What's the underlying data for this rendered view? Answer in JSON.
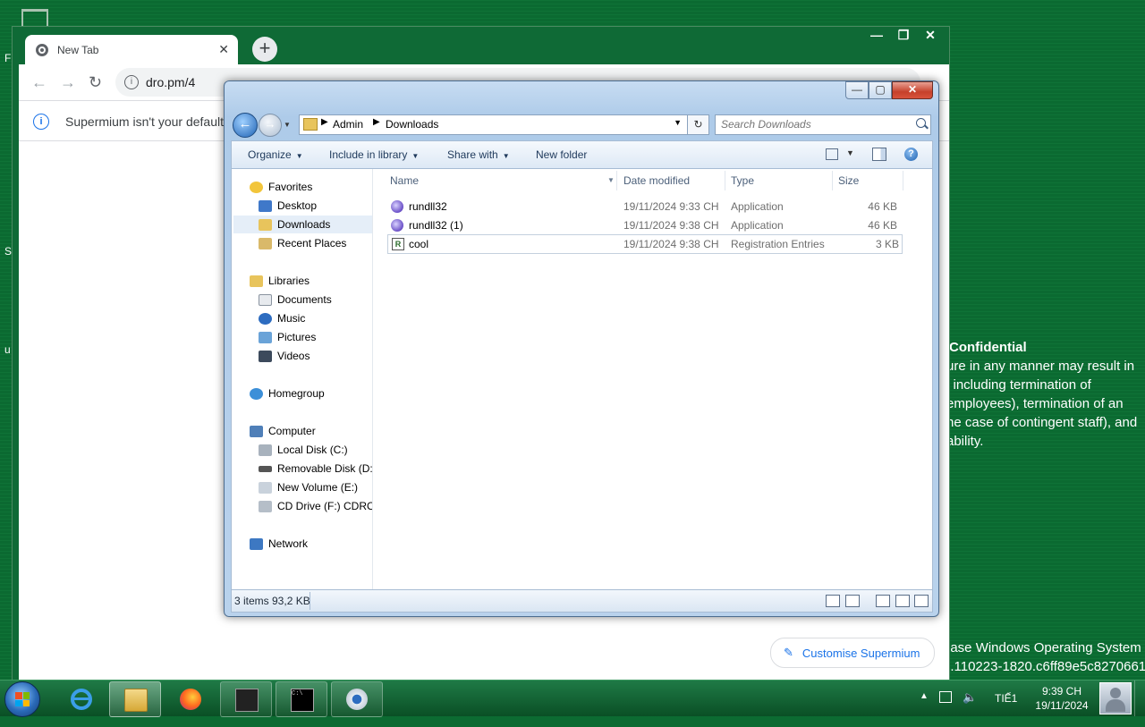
{
  "desktop": {
    "notice_title": "Confidential",
    "notice_lines": [
      "ure in any manner may result in",
      "l including termination of",
      "employees), termination of an",
      "ne case of contingent staff), and",
      "ability."
    ],
    "build_lines": [
      "ease Windows Operating System",
      "2.110223-1820.c6ff89e5c8270661"
    ],
    "edge_letters": [
      "F",
      "Su",
      "u"
    ]
  },
  "browser": {
    "tab_title": "New Tab",
    "tab_close": "✕",
    "new_tab": "+",
    "window_controls": [
      "—",
      "❐",
      "✕"
    ],
    "url": "dro.pm/4",
    "infobar_text": "Supermium isn't your default b",
    "customise_label": "Customise Supermium"
  },
  "explorer": {
    "window_controls": [
      "—",
      "▢",
      "✕"
    ],
    "address": {
      "crumbs": [
        "Admin",
        "Downloads"
      ]
    },
    "search_placeholder": "Search Downloads",
    "commands": {
      "organize": "Organize",
      "include_in_library": "Include in library",
      "share_with": "Share with",
      "new_folder": "New folder",
      "help": "?"
    },
    "nav": {
      "favorites": "Favorites",
      "desktop": "Desktop",
      "downloads": "Downloads",
      "recent_places": "Recent Places",
      "libraries": "Libraries",
      "documents": "Documents",
      "music": "Music",
      "pictures": "Pictures",
      "videos": "Videos",
      "homegroup": "Homegroup",
      "computer": "Computer",
      "local_disk": "Local Disk (C:)",
      "removable_disk": "Removable Disk (D:)",
      "new_volume": "New Volume (E:)",
      "cd_drive": "CD Drive (F:) CDROM",
      "network": "Network"
    },
    "columns": {
      "name": "Name",
      "date_modified": "Date modified",
      "type": "Type",
      "size": "Size"
    },
    "files": [
      {
        "name": "rundll32",
        "date": "19/11/2024 9:33 CH",
        "type": "Application",
        "size": "46 KB"
      },
      {
        "name": "rundll32 (1)",
        "date": "19/11/2024 9:38 CH",
        "type": "Application",
        "size": "46 KB"
      },
      {
        "name": "cool",
        "date": "19/11/2024 9:38 CH",
        "type": "Registration Entries",
        "size": "3 KB"
      }
    ],
    "status_text": "3 items 93,2 KB"
  },
  "taskbar": {
    "apps": [
      "Internet Explorer",
      "Windows Explorer",
      "Firefox",
      "Console",
      "Command Prompt",
      "Supermium"
    ],
    "language": "TIẾ1",
    "time": "9:39 CH",
    "date": "19/11/2024"
  },
  "colors": {
    "desktop_green": "#0b6a31",
    "explorer_frame": "#b9d2ec",
    "link_blue": "#1a73e8"
  }
}
